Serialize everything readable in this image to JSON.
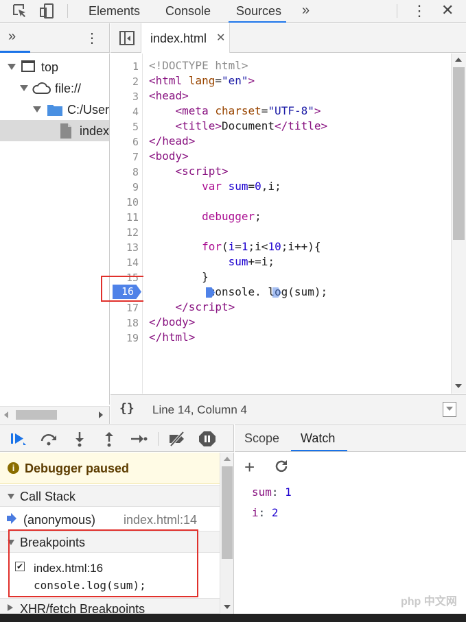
{
  "toolbar": {
    "tabs": [
      "Elements",
      "Console",
      "Sources"
    ],
    "more_tabs_icon": "double-chevron-right-icon",
    "active_tab": "Sources"
  },
  "navigator": {
    "tree": [
      {
        "label": "top",
        "icon": "frame-icon"
      },
      {
        "label": "file://",
        "icon": "cloud-icon"
      },
      {
        "label": "C:/User",
        "icon": "folder-icon"
      },
      {
        "label": "index",
        "icon": "file-icon"
      }
    ]
  },
  "editor": {
    "tab_label": "index.html",
    "line_numbers": [
      "1",
      "2",
      "3",
      "4",
      "5",
      "6",
      "7",
      "8",
      "9",
      "10",
      "11",
      "12",
      "13",
      "14",
      "15",
      "16",
      "17",
      "18",
      "19"
    ],
    "status": "Line 14, Column 4",
    "format_icon": "{}"
  },
  "debugger": {
    "paused_text": "Debugger paused",
    "call_stack_title": "Call Stack",
    "call_stack": [
      {
        "name": "(anonymous)",
        "location": "index.html:14"
      }
    ],
    "breakpoints_title": "Breakpoints",
    "breakpoint": {
      "location": "index.html:16",
      "code": "console.log(sum);",
      "checked": true
    },
    "xhr_title": "XHR/fetch Breakpoints"
  },
  "sidebar": {
    "tabs": [
      "Scope",
      "Watch"
    ],
    "active_tab": "Watch",
    "watch": [
      {
        "name": "sum",
        "value": "1"
      },
      {
        "name": "i",
        "value": "2"
      }
    ]
  },
  "watermark": "php 中文网"
}
